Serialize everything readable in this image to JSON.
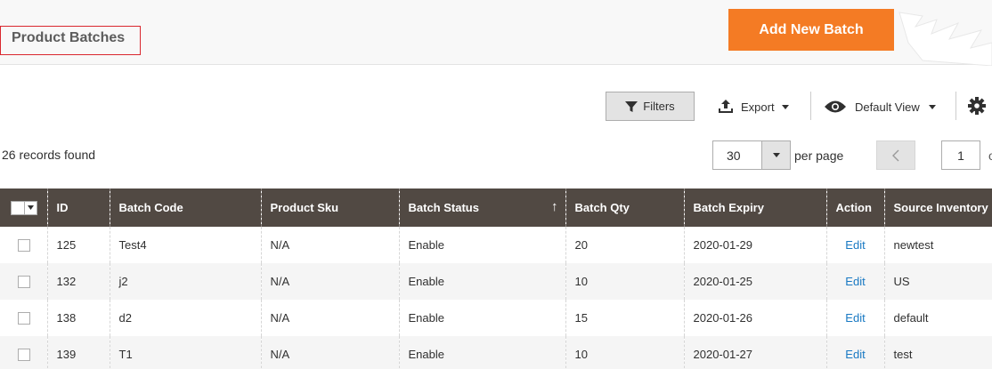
{
  "header": {
    "title": "Product Batches",
    "add_button": "Add New Batch"
  },
  "toolbar": {
    "filters_label": "Filters",
    "export_label": "Export",
    "view_label": "Default View"
  },
  "records": {
    "count_text": "26 records found"
  },
  "pagination": {
    "per_page_value": "30",
    "per_page_label": "per page",
    "current_page": "1"
  },
  "grid": {
    "columns": [
      "ID",
      "Batch Code",
      "Product Sku",
      "Batch Status",
      "Batch Qty",
      "Batch Expiry",
      "Action",
      "Source Inventory"
    ],
    "sorted_column": "Batch Status",
    "sort_direction_glyph": "↑",
    "rows": [
      {
        "id": "125",
        "code": "Test4",
        "sku": "N/A",
        "status": "Enable",
        "qty": "20",
        "expiry": "2020-01-29",
        "action": "Edit",
        "source": "newtest"
      },
      {
        "id": "132",
        "code": "j2",
        "sku": "N/A",
        "status": "Enable",
        "qty": "10",
        "expiry": "2020-01-25",
        "action": "Edit",
        "source": "US"
      },
      {
        "id": "138",
        "code": "d2",
        "sku": "N/A",
        "status": "Enable",
        "qty": "15",
        "expiry": "2020-01-26",
        "action": "Edit",
        "source": "default"
      },
      {
        "id": "139",
        "code": "T1",
        "sku": "N/A",
        "status": "Enable",
        "qty": "10",
        "expiry": "2020-01-27",
        "action": "Edit",
        "source": "test"
      }
    ]
  },
  "colors": {
    "accent": "#f47b24",
    "header_bg": "#514943",
    "link": "#1979c3",
    "title_border": "#d9272e"
  },
  "icons": {
    "filters": "funnel-icon",
    "export": "upload-icon",
    "view": "eye-icon",
    "settings": "gear-icon"
  }
}
